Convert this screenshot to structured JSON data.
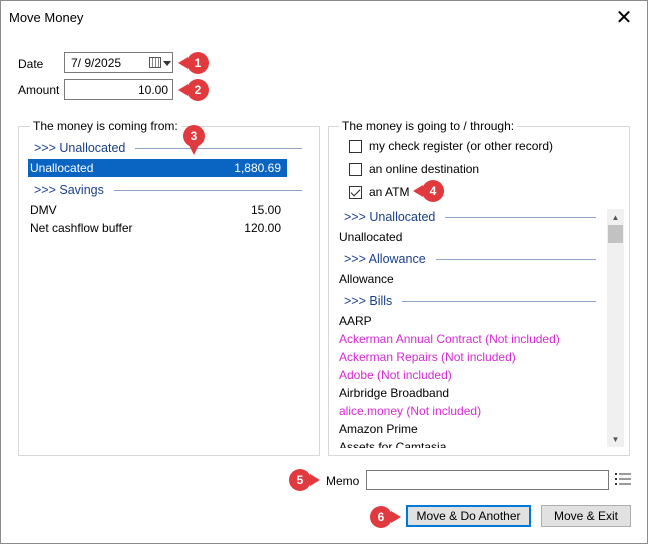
{
  "window": {
    "title": "Move Money",
    "close_glyph": "✕"
  },
  "date": {
    "label": "Date",
    "value": "7/  9/2025"
  },
  "amount": {
    "label": "Amount",
    "value": "10.00"
  },
  "from_group": {
    "legend": "The money is coming from:",
    "sections": [
      {
        "header": ">>> Unallocated",
        "rows": [
          {
            "name": "Unallocated",
            "amount": "1,880.69",
            "selected": true
          }
        ]
      },
      {
        "header": ">>> Savings",
        "rows": [
          {
            "name": "DMV",
            "amount": "15.00"
          },
          {
            "name": "Net cashflow buffer",
            "amount": "120.00"
          }
        ]
      }
    ]
  },
  "to_group": {
    "legend": "The money is going to / through:",
    "options": [
      {
        "label": "my check register (or other record)",
        "checked": false
      },
      {
        "label": "an online destination",
        "checked": false
      },
      {
        "label": "an ATM",
        "checked": true
      }
    ],
    "list": [
      {
        "type": "header",
        "text": ">>> Unallocated"
      },
      {
        "type": "item",
        "text": "Unallocated"
      },
      {
        "type": "header",
        "text": ">>> Allowance"
      },
      {
        "type": "item",
        "text": "Allowance"
      },
      {
        "type": "header",
        "text": ">>> Bills"
      },
      {
        "type": "item",
        "text": "AARP"
      },
      {
        "type": "excluded",
        "text": "Ackerman Annual Contract (Not included)"
      },
      {
        "type": "excluded",
        "text": "Ackerman Repairs (Not included)"
      },
      {
        "type": "excluded",
        "text": "Adobe (Not included)"
      },
      {
        "type": "item",
        "text": "Airbridge Broadband"
      },
      {
        "type": "excluded",
        "text": "alice.money (Not included)"
      },
      {
        "type": "item",
        "text": "Amazon Prime"
      },
      {
        "type": "item",
        "text": "Assets for Camtasia"
      }
    ]
  },
  "memo": {
    "label": "Memo",
    "value": ""
  },
  "buttons": {
    "move_another": "Move & Do Another",
    "move_exit": "Move & Exit"
  },
  "annotations": [
    "1",
    "2",
    "3",
    "4",
    "5",
    "6"
  ],
  "colors": {
    "selection": "#0a64c2",
    "section_header": "#1a3f8a",
    "excluded": "#d42ad4",
    "annotation": "#e03a3e"
  },
  "icons": {
    "calendar": "calendar-icon",
    "dropdown": "chevron-down-icon",
    "list": "list-icon",
    "close": "close-icon"
  }
}
